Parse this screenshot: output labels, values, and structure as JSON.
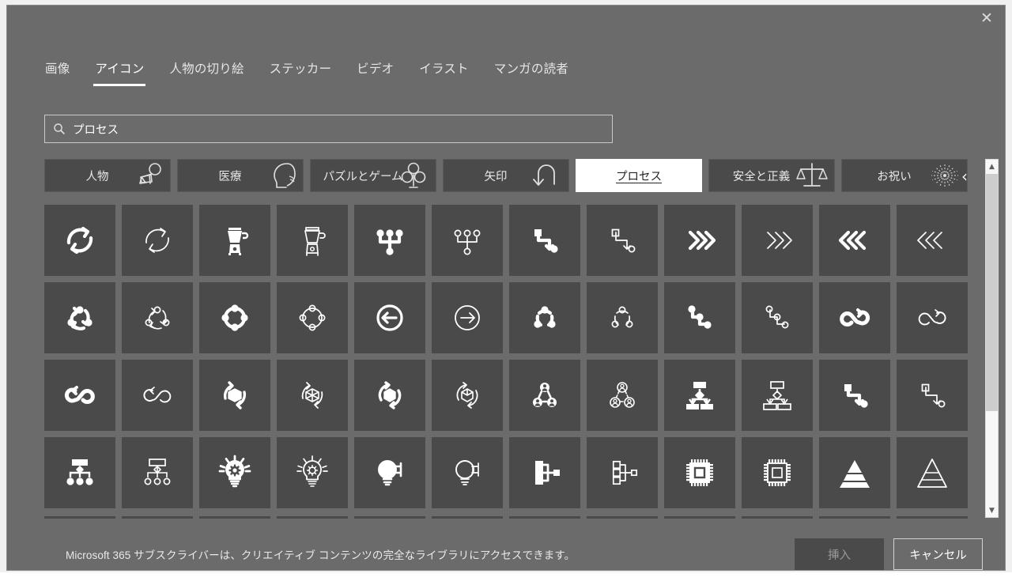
{
  "window": {
    "close_label": "✕"
  },
  "tabs": [
    {
      "label": "画像",
      "active": false
    },
    {
      "label": "アイコン",
      "active": true
    },
    {
      "label": "人物の切り絵",
      "active": false
    },
    {
      "label": "ステッカー",
      "active": false
    },
    {
      "label": "ビデオ",
      "active": false
    },
    {
      "label": "イラスト",
      "active": false
    },
    {
      "label": "マンガの読者",
      "active": false
    }
  ],
  "search": {
    "value": "プロセス",
    "placeholder": "プロセス",
    "icon": "search-icon"
  },
  "chips": [
    {
      "label": "人物",
      "icon": "baby-crawling-icon",
      "selected": false
    },
    {
      "label": "医療",
      "icon": "head-profile-icon",
      "selected": false
    },
    {
      "label": "パズルとゲーム",
      "icon": "club-suit-icon",
      "selected": false
    },
    {
      "label": "矢印",
      "icon": "u-turn-arrow-icon",
      "selected": false
    },
    {
      "label": "プロセス",
      "icon": "none",
      "selected": true
    },
    {
      "label": "安全と正義",
      "icon": "scales-balance-icon",
      "selected": false
    },
    {
      "label": "お祝い",
      "icon": "fireworks-icon",
      "selected": false
    }
  ],
  "chips_more_label": "‹",
  "grid": {
    "icons": [
      {
        "name": "refresh-cycle-filled-icon",
        "shape": "cycle2",
        "fill": true
      },
      {
        "name": "refresh-cycle-outline-icon",
        "shape": "cycle2",
        "fill": false
      },
      {
        "name": "blender-filled-icon",
        "shape": "blender",
        "fill": true
      },
      {
        "name": "blender-outline-icon",
        "shape": "blender",
        "fill": false
      },
      {
        "name": "hierarchy-dots-filled-icon",
        "shape": "treedots",
        "fill": true
      },
      {
        "name": "hierarchy-dots-outline-icon",
        "shape": "treedots",
        "fill": false
      },
      {
        "name": "step-path-filled-icon",
        "shape": "steppath",
        "fill": true
      },
      {
        "name": "step-path-outline-icon",
        "shape": "steppath",
        "fill": false
      },
      {
        "name": "chevrons-right-filled-icon",
        "shape": "chevright",
        "fill": true
      },
      {
        "name": "chevrons-right-outline-icon",
        "shape": "chevright",
        "fill": false
      },
      {
        "name": "chevrons-left-filled-icon",
        "shape": "chevleft",
        "fill": true
      },
      {
        "name": "chevrons-left-outline-icon",
        "shape": "chevleft",
        "fill": false
      },
      {
        "name": "three-node-cycle-filled-icon",
        "shape": "cycle3dots",
        "fill": true
      },
      {
        "name": "three-node-cycle-outline-icon",
        "shape": "cycle3dots",
        "fill": false
      },
      {
        "name": "four-node-cycle-filled-icon",
        "shape": "cycle4dots",
        "fill": true
      },
      {
        "name": "four-node-cycle-outline-icon",
        "shape": "cycle4dots",
        "fill": false
      },
      {
        "name": "arrow-left-circle-filled-icon",
        "shape": "arrowcircleleft",
        "fill": true
      },
      {
        "name": "arrow-left-circle-outline-icon",
        "shape": "arrowcircleright",
        "fill": false
      },
      {
        "name": "triangle-cycle-filled-icon",
        "shape": "cycle3arc",
        "fill": true
      },
      {
        "name": "triangle-cycle-outline-icon",
        "shape": "cycle3arc",
        "fill": false
      },
      {
        "name": "zigzag-nodes-filled-icon",
        "shape": "zigzag",
        "fill": true
      },
      {
        "name": "zigzag-nodes-outline-icon",
        "shape": "zigzag",
        "fill": false
      },
      {
        "name": "infinity-loop-filled-icon",
        "shape": "infinityR",
        "fill": true
      },
      {
        "name": "infinity-loop-outline-icon",
        "shape": "infinityR",
        "fill": false
      },
      {
        "name": "infinity-reverse-filled-icon",
        "shape": "infinityL",
        "fill": true
      },
      {
        "name": "infinity-reverse-outline-icon",
        "shape": "infinityL",
        "fill": false
      },
      {
        "name": "recycle-box-filled-icon",
        "shape": "boxcycle",
        "fill": true
      },
      {
        "name": "recycle-box-outline-icon",
        "shape": "boxcycle",
        "fill": false
      },
      {
        "name": "rotate-box-filled-icon",
        "shape": "boxrotate",
        "fill": true
      },
      {
        "name": "rotate-box-outline-icon",
        "shape": "boxrotate",
        "fill": false
      },
      {
        "name": "team-network-filled-icon",
        "shape": "people3",
        "fill": true
      },
      {
        "name": "team-network-outline-icon",
        "shape": "people3",
        "fill": false
      },
      {
        "name": "flowchart-decision-filled-icon",
        "shape": "flowchart",
        "fill": true
      },
      {
        "name": "flowchart-decision-outline-icon",
        "shape": "flowchart",
        "fill": false
      },
      {
        "name": "step-nodes-filled-icon",
        "shape": "steppath",
        "fill": true
      },
      {
        "name": "step-nodes-outline-icon",
        "shape": "steppath",
        "fill": false
      },
      {
        "name": "org-chart-filled-icon",
        "shape": "orgchart",
        "fill": true
      },
      {
        "name": "org-chart-outline-icon",
        "shape": "orgchart",
        "fill": false
      },
      {
        "name": "idea-gear-bulb-filled-icon",
        "shape": "bulbgear",
        "fill": true
      },
      {
        "name": "idea-gear-bulb-outline-icon",
        "shape": "bulbgear",
        "fill": false
      },
      {
        "name": "bulb-plug-filled-icon",
        "shape": "bulbplug",
        "fill": true
      },
      {
        "name": "bulb-plug-outline-icon",
        "shape": "bulbplug",
        "fill": false
      },
      {
        "name": "node-branch-filled-icon",
        "shape": "branch",
        "fill": true
      },
      {
        "name": "node-branch-outline-icon",
        "shape": "branch",
        "fill": false
      },
      {
        "name": "cpu-chip-filled-icon",
        "shape": "cpu",
        "fill": true
      },
      {
        "name": "cpu-chip-outline-icon",
        "shape": "cpu",
        "fill": false
      },
      {
        "name": "pyramid-filled-icon",
        "shape": "pyramid",
        "fill": true
      },
      {
        "name": "pyramid-outline-icon",
        "shape": "pyramid",
        "fill": false
      }
    ]
  },
  "scrollbar": {
    "up_label": "▲",
    "down_label": "▼"
  },
  "footer": {
    "note": "Microsoft 365 サブスクライバーは、クリエイティブ コンテンツの完全なライブラリにアクセスできます。",
    "insert_label": "挿入",
    "cancel_label": "キャンセル"
  },
  "colors": {
    "dialog_bg": "#6b6b6b",
    "cell_bg": "#4a4a4a",
    "accent_text": "#ffffff",
    "selected_chip_bg": "#ffffff"
  }
}
